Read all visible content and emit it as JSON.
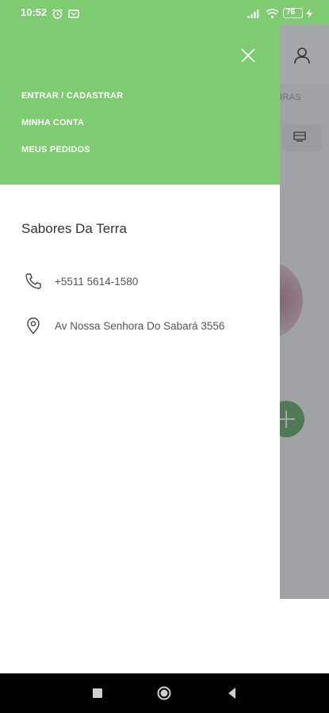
{
  "status_bar": {
    "time": "10:52",
    "icons": [
      "alarm-icon",
      "notification-icon",
      "signal-icon",
      "wifi-icon",
      "battery-icon",
      "charging-icon"
    ],
    "battery_level": "76",
    "background": "#7ecb72"
  },
  "background_app": {
    "tab_text": "DURAS",
    "icons": [
      "user-icon",
      "store-icon",
      "add-icon"
    ],
    "fab_color": "#6bb16a"
  },
  "drawer": {
    "header_color": "#7ecb72",
    "close_icon": "close-icon",
    "menu": [
      {
        "label": "ENTRAR / CADASTRAR"
      },
      {
        "label": "MINHA CONTA"
      },
      {
        "label": "MEUS PEDIDOS"
      }
    ],
    "store": {
      "name": "Sabores Da Terra",
      "phone": "+5511 5614-1580",
      "address": "Av Nossa Senhora Do Sabará 3556"
    }
  },
  "nav_bar": {
    "buttons": [
      "recent-apps-button",
      "home-button",
      "back-button"
    ]
  }
}
